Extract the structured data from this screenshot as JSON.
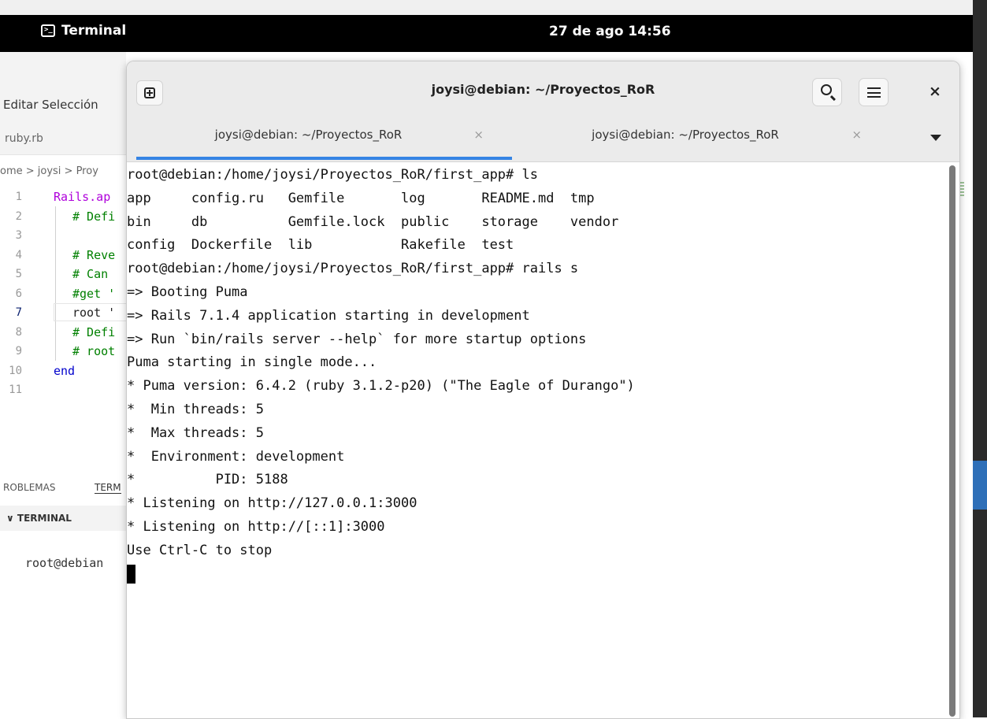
{
  "topbar": {
    "app_name": "Terminal",
    "clock": "27 de ago  14:56"
  },
  "editor": {
    "menu": "Editar  Selección",
    "tab": "ruby.rb",
    "breadcrumb": "ome > joysi > Proy",
    "lines": [
      {
        "num": "1",
        "text": "Rails.ap",
        "style": "kw"
      },
      {
        "num": "2",
        "text": "# Defi",
        "style": "comment"
      },
      {
        "num": "3",
        "text": "",
        "style": "plain"
      },
      {
        "num": "4",
        "text": "# Reve",
        "style": "comment"
      },
      {
        "num": "5",
        "text": "# Can",
        "style": "comment"
      },
      {
        "num": "6",
        "text": "#get '",
        "style": "comment"
      },
      {
        "num": "7",
        "text": "root '",
        "style": "plain"
      },
      {
        "num": "8",
        "text": "# Defi",
        "style": "comment"
      },
      {
        "num": "9",
        "text": "# root",
        "style": "comment"
      },
      {
        "num": "10",
        "text": "end",
        "style": "end"
      },
      {
        "num": "11",
        "text": "",
        "style": "plain"
      }
    ],
    "panel_tab_problems": "ROBLEMAS",
    "panel_tab_terminal": "TERM",
    "terminal_section": "∨ TERMINAL",
    "terminal_prompt": "root@debian"
  },
  "terminal": {
    "window_title": "joysi@debian: ~/Proyectos_RoR",
    "tabs": [
      {
        "label": "joysi@debian: ~/Proyectos_RoR",
        "close": "×"
      },
      {
        "label": "joysi@debian: ~/Proyectos_RoR",
        "close": "×"
      }
    ],
    "close_glyph": "×",
    "lines": [
      "root@debian:/home/joysi/Proyectos_RoR/first_app# ls",
      "app     config.ru   Gemfile       log       README.md  tmp",
      "bin     db          Gemfile.lock  public    storage    vendor",
      "config  Dockerfile  lib           Rakefile  test",
      "root@debian:/home/joysi/Proyectos_RoR/first_app# rails s",
      "=> Booting Puma",
      "=> Rails 7.1.4 application starting in development",
      "=> Run `bin/rails server --help` for more startup options",
      "Puma starting in single mode...",
      "* Puma version: 6.4.2 (ruby 3.1.2-p20) (\"The Eagle of Durango\")",
      "*  Min threads: 5",
      "*  Max threads: 5",
      "*  Environment: development",
      "*          PID: 5188",
      "* Listening on http://127.0.0.1:3000",
      "* Listening on http://[::1]:3000",
      "Use Ctrl-C to stop"
    ]
  }
}
